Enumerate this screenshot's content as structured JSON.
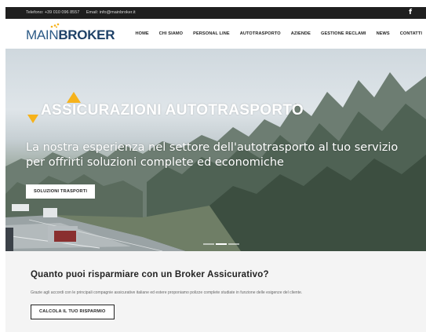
{
  "topbar": {
    "phone": "Telefono: +39 010 096 8557",
    "email": "Email: info@mainbroker.it",
    "social_icon": "f"
  },
  "logo": {
    "main": "MAIN",
    "broker": "BROKER"
  },
  "nav": [
    {
      "label": "HOME"
    },
    {
      "label": "CHI SIAMO"
    },
    {
      "label": "PERSONAL LINE"
    },
    {
      "label": "AUTOTRASPORTO"
    },
    {
      "label": "AZIENDE"
    },
    {
      "label": "GESTIONE RECLAMI"
    },
    {
      "label": "NEWS"
    },
    {
      "label": "CONTATTI"
    }
  ],
  "hero": {
    "title": "ASSICURAZIONI AUTOTRASPORTO",
    "subtitle": "La nostra esperienza nel settore dell'autotrasporto al tuo servizio per offrirti soluzioni complete ed economiche",
    "button": "SOLUZIONI TRASPORTI",
    "slides": 3,
    "active_slide": 2
  },
  "promo": {
    "heading": "Quanto puoi risparmiare con un Broker Assicurativo?",
    "text": "Grazie agli accordi con le principali compagnie assicurative italiane ed estere proponiamo polizze complete studiate in funzione delle esigenze del cliente.",
    "button": "CALCOLA IL TUO RISPARMIO"
  },
  "colors": {
    "accent": "#f6b21b",
    "brand_dark": "#1e4167",
    "brand": "#2c5a86",
    "topbar": "#1f1f1f"
  }
}
